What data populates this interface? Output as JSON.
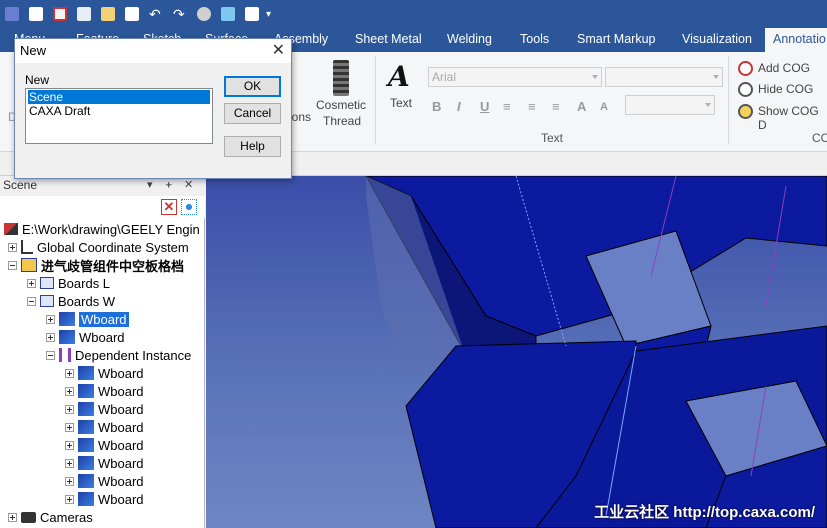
{
  "quick_access": {
    "icons": [
      "app-menu-icon",
      "new-file-icon",
      "print-icon",
      "save-as-icon",
      "open-folder-icon",
      "save-icon",
      "undo-icon",
      "redo-icon",
      "sphere-icon",
      "pattern-icon",
      "properties-icon"
    ],
    "dropdown": "▾"
  },
  "ribbon": {
    "tabs": [
      "Menu",
      "Feature",
      "Sketch",
      "Surface",
      "Assembly",
      "Sheet Metal",
      "Welding",
      "Tools",
      "Smart Markup",
      "Visualization",
      "Annotatio"
    ],
    "active_tab": "Annotatio",
    "ions_label": "ions",
    "cosmetic": {
      "line1": "Cosmetic",
      "line2": "Thread"
    },
    "text_group": {
      "button_label": "Text",
      "font_value": "Arial",
      "group_label": "Text",
      "format_buttons": [
        "B",
        "I",
        "U",
        "≡",
        "≡",
        "≡",
        "A",
        "A"
      ]
    },
    "cog": {
      "add": "Add COG",
      "hide": "Hide COG",
      "show": "Show COG D",
      "group_label": "CO"
    },
    "hidden_left_label": "D"
  },
  "panel": {
    "title": "Scene",
    "pin": "▾",
    "dock": "ᚐ",
    "close": "✕"
  },
  "tree": {
    "root": "E:\\Work\\drawing\\GEELY Engin",
    "global": "Global Coordinate System",
    "assembly": "进气歧管组件中空板格档",
    "boards_l": "Boards L",
    "boards_w": "Boards W",
    "wboard_selected": "Wboard",
    "wboard_2": "Wboard",
    "dependent": "Dependent Instance",
    "dependent_children": [
      "Wboard",
      "Wboard",
      "Wboard",
      "Wboard",
      "Wboard",
      "Wboard",
      "Wboard",
      "Wboard"
    ],
    "cameras": "Cameras"
  },
  "dialog": {
    "title": "New",
    "close": "✕",
    "label": "New",
    "items": [
      "Scene",
      "CAXA Draft"
    ],
    "selected": "Scene",
    "ok": "OK",
    "cancel": "Cancel",
    "help": "Help"
  },
  "watermark": "工业云社区 http://top.caxa.com/",
  "colors": {
    "title_bar": "#2b579a",
    "model_blue": "#0a1a9e",
    "selection": "#0078d7"
  }
}
